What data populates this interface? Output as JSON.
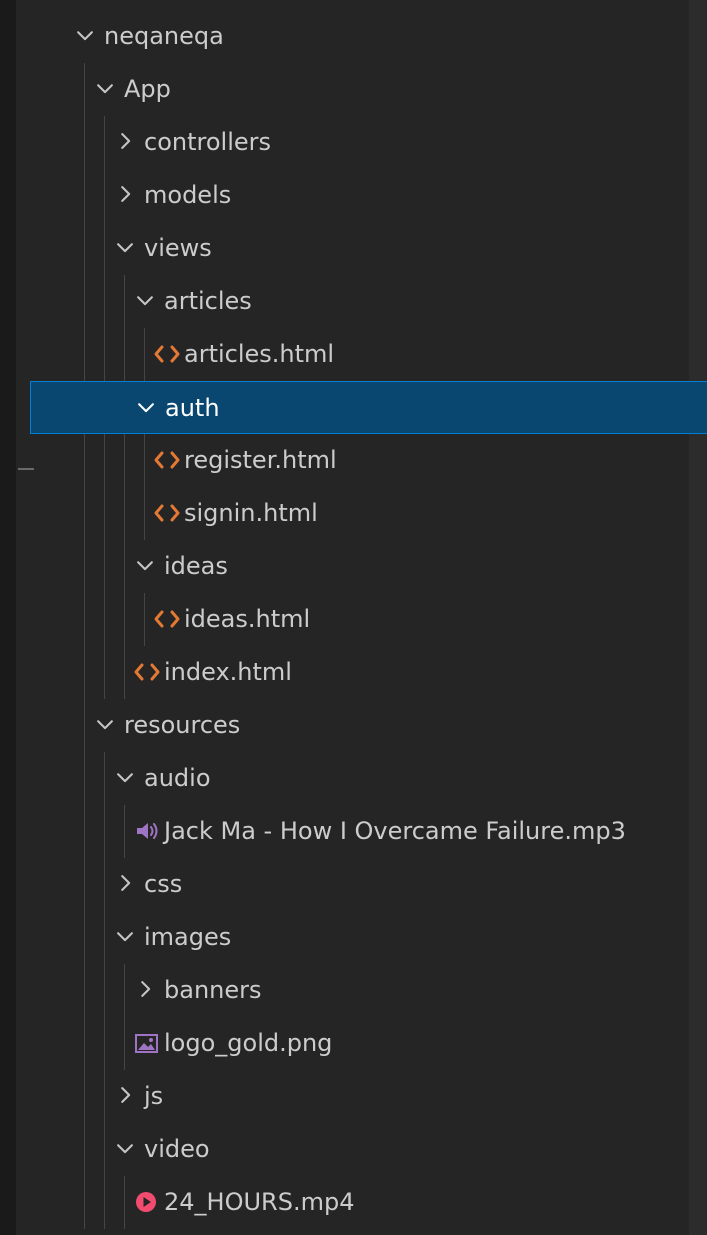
{
  "explorer": {
    "colors": {
      "background": "#252526",
      "text": "#cccccc",
      "selection": "#094771",
      "selection_border": "#007fd4",
      "html_icon": "#e37933",
      "audio_icon": "#a074c4",
      "image_icon": "#a074c4",
      "video_icon": "#f14c70"
    },
    "tree": [
      {
        "label": "neqaneqa",
        "type": "folder",
        "expanded": true,
        "level": 0
      },
      {
        "label": "App",
        "type": "folder",
        "expanded": true,
        "level": 1
      },
      {
        "label": "controllers",
        "type": "folder",
        "expanded": false,
        "level": 2
      },
      {
        "label": "models",
        "type": "folder",
        "expanded": false,
        "level": 2
      },
      {
        "label": "views",
        "type": "folder",
        "expanded": true,
        "level": 2
      },
      {
        "label": "articles",
        "type": "folder",
        "expanded": true,
        "level": 3
      },
      {
        "label": "articles.html",
        "type": "file",
        "icon": "html-icon",
        "level": 4
      },
      {
        "label": "auth",
        "type": "folder",
        "expanded": true,
        "level": 3,
        "selected": true
      },
      {
        "label": "register.html",
        "type": "file",
        "icon": "html-icon",
        "level": 4
      },
      {
        "label": "signin.html",
        "type": "file",
        "icon": "html-icon",
        "level": 4
      },
      {
        "label": "ideas",
        "type": "folder",
        "expanded": true,
        "level": 3
      },
      {
        "label": "ideas.html",
        "type": "file",
        "icon": "html-icon",
        "level": 4
      },
      {
        "label": "index.html",
        "type": "file",
        "icon": "html-icon",
        "level": 3
      },
      {
        "label": "resources",
        "type": "folder",
        "expanded": true,
        "level": 1
      },
      {
        "label": "audio",
        "type": "folder",
        "expanded": true,
        "level": 2
      },
      {
        "label": "Jack Ma - How I Overcame Failure.mp3",
        "type": "file",
        "icon": "audio-file-icon",
        "level": 3
      },
      {
        "label": "css",
        "type": "folder",
        "expanded": false,
        "level": 2
      },
      {
        "label": "images",
        "type": "folder",
        "expanded": true,
        "level": 2
      },
      {
        "label": "banners",
        "type": "folder",
        "expanded": false,
        "level": 3
      },
      {
        "label": "logo_gold.png",
        "type": "file",
        "icon": "image-file-icon",
        "level": 3
      },
      {
        "label": "js",
        "type": "folder",
        "expanded": false,
        "level": 2
      },
      {
        "label": "video",
        "type": "folder",
        "expanded": true,
        "level": 2
      },
      {
        "label": "24_HOURS.mp4",
        "type": "file",
        "icon": "video-file-icon",
        "level": 3
      }
    ]
  }
}
